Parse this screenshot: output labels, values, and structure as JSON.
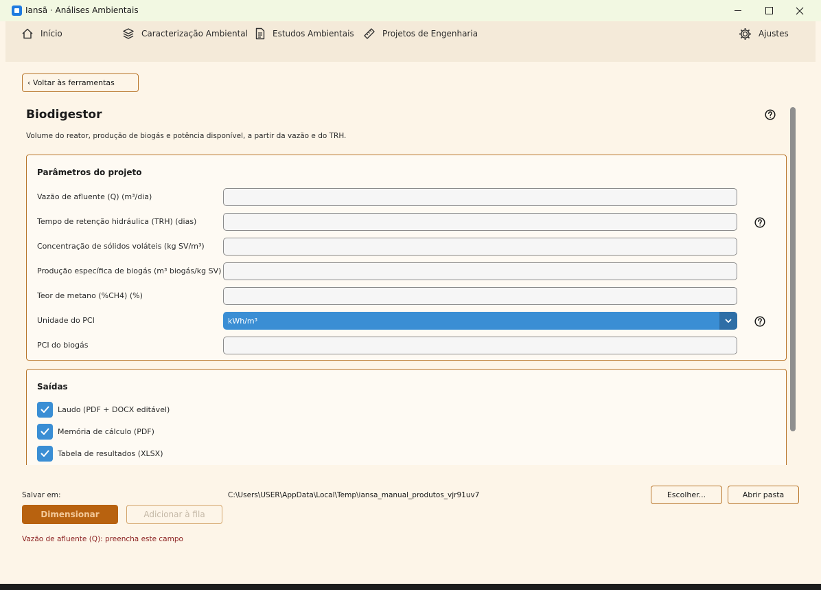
{
  "window": {
    "title": "Iansã · Análises Ambientais"
  },
  "nav": {
    "items": [
      {
        "label": "Início",
        "icon": "home-icon"
      },
      {
        "label": "Caracterização Ambiental",
        "icon": "layers-icon"
      },
      {
        "label": "Estudos Ambientais",
        "icon": "document-icon"
      },
      {
        "label": "Projetos de Engenharia",
        "icon": "ruler-icon"
      }
    ],
    "settings_label": "Ajustes"
  },
  "back_button": "‹ Voltar às ferramentas",
  "page": {
    "title": "Biodigestor",
    "description": "Volume do reator, produção de biogás e potência disponível, a partir da vazão e do TRH."
  },
  "params": {
    "title": "Parâmetros do projeto",
    "fields": [
      {
        "label": "Vazão de afluente (Q) (m³/dia)",
        "value": ""
      },
      {
        "label": "Tempo de retenção hidráulica (TRH) (dias)",
        "value": ""
      },
      {
        "label": "Concentração de sólidos voláteis (kg SV/m³)",
        "value": ""
      },
      {
        "label": "Produção específica de biogás (m³ biogás/kg SV)",
        "value": ""
      },
      {
        "label": "Teor de metano (%CH4) (%)",
        "value": ""
      },
      {
        "label": "Unidade do PCI",
        "selected": "kWh/m³"
      },
      {
        "label": "PCI do biogás",
        "value": ""
      }
    ]
  },
  "outputs": {
    "title": "Saídas",
    "items": [
      {
        "label": "Laudo (PDF + DOCX editável)",
        "checked": true
      },
      {
        "label": "Memória de cálculo (PDF)",
        "checked": true
      },
      {
        "label": "Tabela de resultados (XLSX)",
        "checked": true
      }
    ]
  },
  "footer": {
    "save_label": "Salvar em:",
    "save_path": "C:\\Users\\USER\\AppData\\Local\\Temp\\iansa_manual_produtos_vjr91uv7",
    "choose_button": "Escolher...",
    "open_button": "Abrir pasta",
    "primary_button": "Dimensionar",
    "queue_button": "Adicionar à fila",
    "error_message": "Vazão de afluente (Q): preencha este campo"
  },
  "colors": {
    "accent": "#b8620f",
    "select_blue": "#3a8ed4",
    "error": "#8b1f1f"
  }
}
